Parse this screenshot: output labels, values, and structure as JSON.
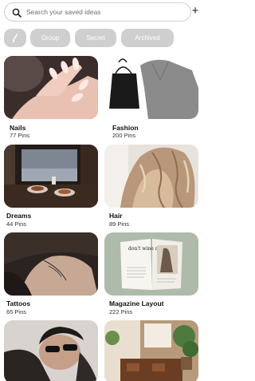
{
  "search": {
    "placeholder": "Search your saved ideas"
  },
  "filters": {
    "group": "Group",
    "secret": "Secret",
    "archived": "Archived"
  },
  "boards": [
    {
      "title": "Nails",
      "pins": "77 Pins"
    },
    {
      "title": "Fashion",
      "pins": "200 Pins"
    },
    {
      "title": "Dreams",
      "pins": "44 Pins"
    },
    {
      "title": "Hair",
      "pins": "89 Pins"
    },
    {
      "title": "Tattoos",
      "pins": "65 Pins"
    },
    {
      "title": "Magazine Layout",
      "pins": "222 Pins"
    }
  ],
  "magazine_cover_text": "don't wine about it",
  "icons": {
    "search": "search-icon",
    "add": "plus-icon",
    "filter": "brush-icon"
  }
}
